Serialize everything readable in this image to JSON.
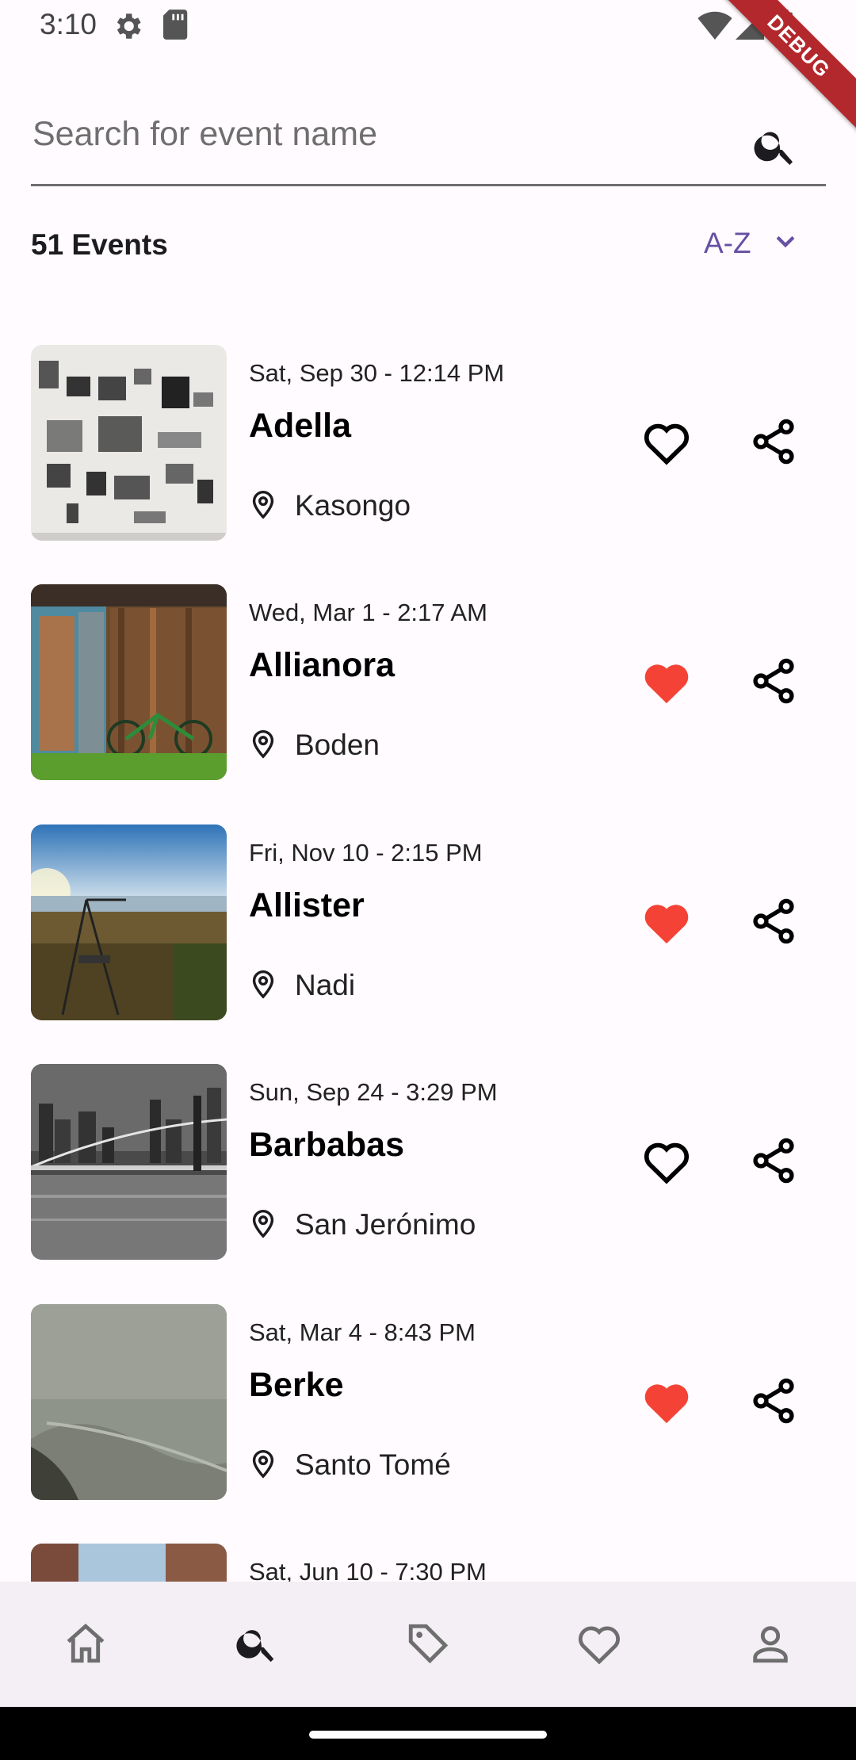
{
  "status_bar": {
    "time": "3:10",
    "debug_label": "DEBUG"
  },
  "search": {
    "placeholder": "Search for event name",
    "value": ""
  },
  "summary": {
    "count_label": "51 Events",
    "sort_label": "A-Z"
  },
  "events": [
    {
      "date": "Sat, Sep 30 - 12:14 PM",
      "name": "Adella",
      "location": "Kasongo",
      "favorite": false
    },
    {
      "date": "Wed, Mar 1 - 2:17 AM",
      "name": "Allianora",
      "location": "Boden",
      "favorite": true
    },
    {
      "date": "Fri, Nov 10 - 2:15 PM",
      "name": "Allister",
      "location": "Nadi",
      "favorite": true
    },
    {
      "date": "Sun, Sep 24 - 3:29 PM",
      "name": "Barbabas",
      "location": "San Jerónimo",
      "favorite": false
    },
    {
      "date": "Sat, Mar 4 - 8:43 PM",
      "name": "Berke",
      "location": "Santo Tomé",
      "favorite": true
    },
    {
      "date": "Sat, Jun 10 - 7:30 PM",
      "name": "",
      "location": "",
      "favorite": false
    }
  ],
  "bottom_nav": [
    {
      "icon": "home-icon",
      "active": false
    },
    {
      "icon": "search-icon",
      "active": true
    },
    {
      "icon": "tag-icon",
      "active": false
    },
    {
      "icon": "heart-icon",
      "active": false
    },
    {
      "icon": "profile-icon",
      "active": false
    }
  ],
  "colors": {
    "accent": "#6750a4",
    "favorite": "#f44336",
    "background": "#fffbfe",
    "nav_background": "#f3eff4"
  }
}
